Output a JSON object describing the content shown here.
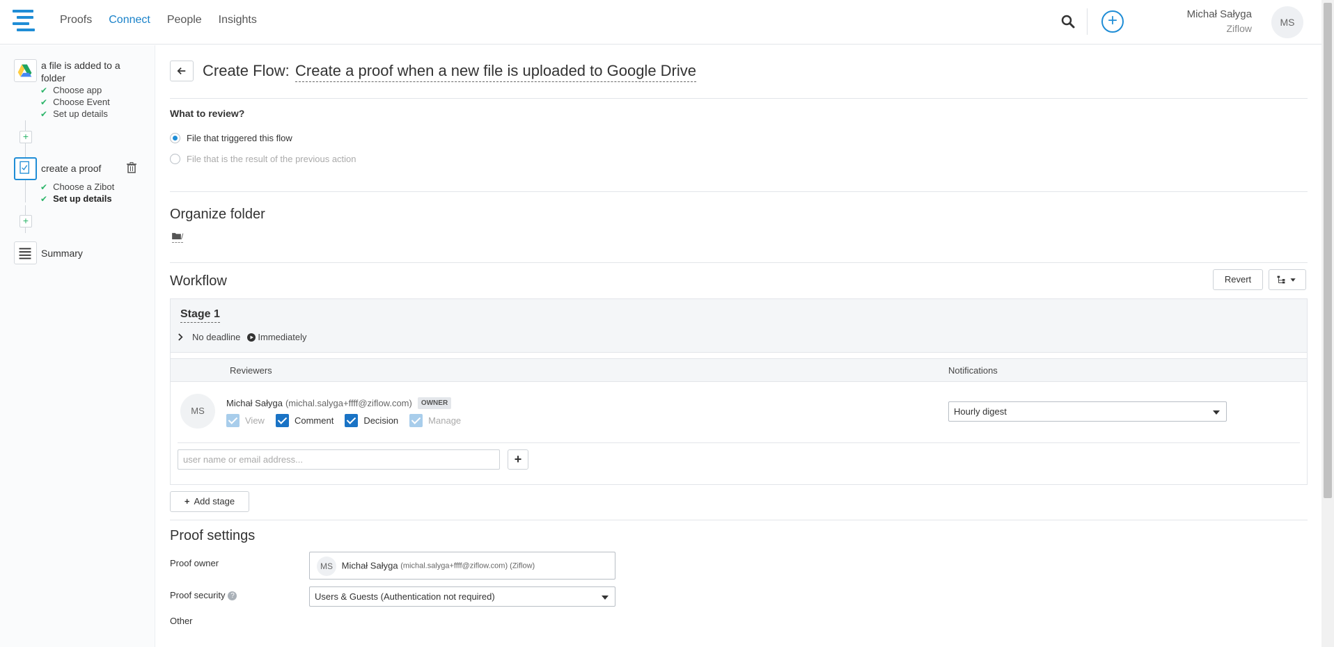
{
  "nav": {
    "items": [
      {
        "label": "Proofs"
      },
      {
        "label": "Connect"
      },
      {
        "label": "People"
      },
      {
        "label": "Insights"
      }
    ]
  },
  "user": {
    "name": "Michał Sałyga",
    "org": "Ziflow",
    "initials": "MS"
  },
  "sidebar": {
    "trigger": {
      "title": "a file is added to a folder",
      "steps": [
        "Choose app",
        "Choose Event",
        "Set up details"
      ]
    },
    "action": {
      "title": "create a proof",
      "steps": [
        "Choose a Zibot",
        "Set up details"
      ]
    },
    "summary": "Summary"
  },
  "header": {
    "prefix": "Create Flow:",
    "name": "Create a proof when a new file is uploaded to Google Drive"
  },
  "review": {
    "label": "What to review?",
    "options": [
      {
        "label": "File that triggered this flow",
        "checked": true
      },
      {
        "label": "File that is the result of the previous action",
        "checked": false
      }
    ]
  },
  "organize": {
    "heading": "Organize folder",
    "path": "/"
  },
  "workflow": {
    "heading": "Workflow",
    "revert_label": "Revert",
    "stage": {
      "title": "Stage 1",
      "deadline": "No deadline",
      "start": "Immediately",
      "col_reviewers": "Reviewers",
      "col_notifications": "Notifications",
      "reviewer": {
        "initials": "MS",
        "name": "Michał Sałyga",
        "email": "(michal.salyga+ffff@ziflow.com)",
        "badge": "OWNER",
        "permissions": [
          {
            "label": "View",
            "state": "faded"
          },
          {
            "label": "Comment",
            "state": "on"
          },
          {
            "label": "Decision",
            "state": "on"
          },
          {
            "label": "Manage",
            "state": "faded"
          }
        ],
        "notification": "Hourly digest"
      },
      "add_placeholder": "user name or email address..."
    },
    "add_stage_label": "Add stage"
  },
  "proof_settings": {
    "heading": "Proof settings",
    "owner_label": "Proof owner",
    "owner_initials": "MS",
    "owner_name": "Michał Sałyga",
    "owner_detail": "(michal.salyga+ffff@ziflow.com) (Ziflow)",
    "security_label": "Proof security",
    "security_value": "Users & Guests (Authentication not required)",
    "other_label": "Other"
  },
  "colors": {
    "accent": "#1f8dd6",
    "check_green": "#2db56a",
    "checkbox_blue": "#1a73c5"
  }
}
